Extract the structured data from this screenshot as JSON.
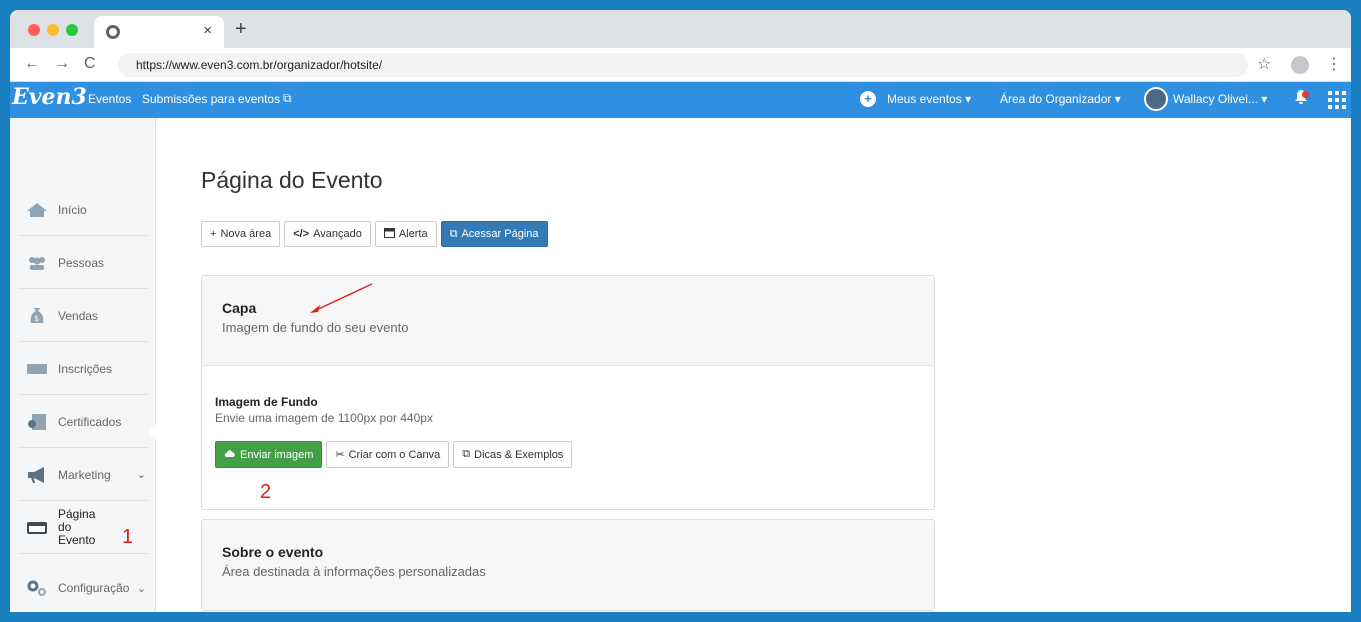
{
  "browser": {
    "tab_close": "×",
    "new_tab": "+",
    "url": "https://www.even3.com.br/organizador/hotsite/",
    "back": "←",
    "forward": "→",
    "reload": "C",
    "bookmark": "☆",
    "menu": "⋮"
  },
  "topnav": {
    "logo": "Even3",
    "links": [
      "Eventos",
      "Submissões para eventos"
    ],
    "external_icon": "⧉",
    "my_events": "Meus eventos",
    "organizer_area": "Área do Organizador",
    "user": "Wallacy Olivei...",
    "caret": "▾"
  },
  "sidebar": {
    "items": [
      {
        "label": "Início",
        "icon": "home-icon",
        "glyph": "⌂"
      },
      {
        "label": "Pessoas",
        "icon": "people-icon",
        "glyph": "👥"
      },
      {
        "label": "Vendas",
        "icon": "money-bag-icon",
        "glyph": "$"
      },
      {
        "label": "Inscrições",
        "icon": "ticket-icon",
        "glyph": "▬"
      },
      {
        "label": "Certificados",
        "icon": "certificate-icon",
        "glyph": "▣"
      },
      {
        "label": "Marketing",
        "icon": "megaphone-icon",
        "glyph": "📢"
      },
      {
        "label": "Página do Evento",
        "icon": "browser-window-icon",
        "glyph": "▭"
      },
      {
        "label": "Configuração",
        "icon": "gears-icon",
        "glyph": "⚙"
      }
    ],
    "chevron": "⌄"
  },
  "annotations": {
    "sidebar_marker": "1",
    "upload_marker": "2"
  },
  "main": {
    "title": "Página do Evento",
    "toolbar": {
      "new_area": "Nova área",
      "advanced": "Avançado",
      "alert": "Alerta",
      "open_page": "Acessar Página"
    },
    "cover_card": {
      "title": "Capa",
      "subtitle": "Imagem de fundo do seu evento",
      "field_label": "Imagem de Fundo",
      "field_help": "Envie uma imagem de 1100px por 440px",
      "upload": "Enviar imagem",
      "canva": "Criar com o Canva",
      "tips": "Dicas & Exemplos"
    },
    "about_card": {
      "title": "Sobre o evento",
      "subtitle": "Área destinada à informações personalizadas"
    }
  },
  "colors": {
    "frame": "#1a7fc1",
    "topnav": "#2f8fe0",
    "primary_button": "#337ab7",
    "success_button": "#43a047",
    "annotation": "#e01b1b"
  }
}
